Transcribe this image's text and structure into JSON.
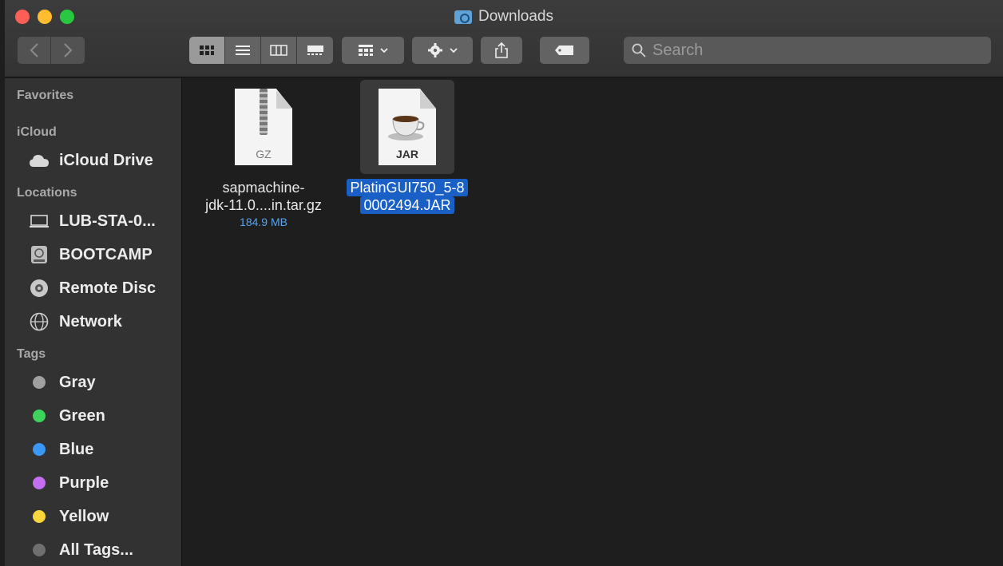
{
  "window": {
    "title": "Downloads"
  },
  "toolbar": {
    "search_placeholder": "Search"
  },
  "sidebar": {
    "sections": {
      "favorites": "Favorites",
      "icloud": "iCloud",
      "locations": "Locations",
      "tags": "Tags"
    },
    "icloud_items": [
      {
        "label": "iCloud Drive",
        "icon": "cloud-icon"
      }
    ],
    "location_items": [
      {
        "label": "LUB-STA-0...",
        "icon": "laptop-icon"
      },
      {
        "label": "BOOTCAMP",
        "icon": "drive-icon"
      },
      {
        "label": "Remote Disc",
        "icon": "disc-icon"
      },
      {
        "label": "Network",
        "icon": "network-icon"
      }
    ],
    "tag_items": [
      {
        "label": "Gray",
        "color": "#a0a0a0"
      },
      {
        "label": "Green",
        "color": "#3ed35a"
      },
      {
        "label": "Blue",
        "color": "#3a97f5"
      },
      {
        "label": "Purple",
        "color": "#c46ef0"
      },
      {
        "label": "Yellow",
        "color": "#f9d63c"
      },
      {
        "label": "All Tags...",
        "color": "#6f6f6f"
      }
    ]
  },
  "files": [
    {
      "name_line1": "sapmachine-",
      "name_line2": "jdk-11.0....in.tar.gz",
      "size": "184.9 MB",
      "ext": "GZ",
      "icon": "archive-file-icon",
      "selected": false
    },
    {
      "name_line1": "PlatinGUI750_5-8",
      "name_line2": "0002494.JAR",
      "size": "",
      "ext": "JAR",
      "icon": "java-file-icon",
      "selected": true
    }
  ]
}
